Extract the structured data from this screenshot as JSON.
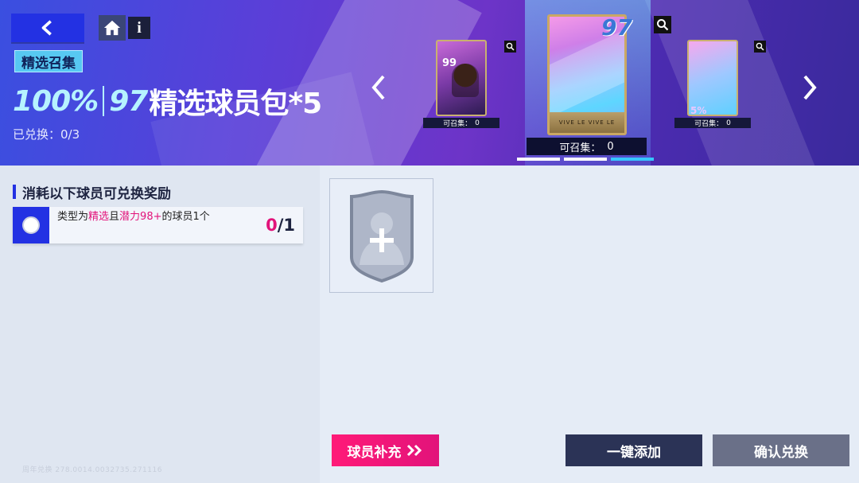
{
  "header": {
    "tag": "精选召集",
    "pack_percent": "100%",
    "pack_ovr": "97",
    "pack_name": "精选球员包*5",
    "redeemed_label": "已兑换：",
    "redeemed_value": "0/3"
  },
  "carousel": {
    "left_card": {
      "ovr": "99",
      "label": "可召集：",
      "count": "0"
    },
    "center_card": {
      "ovr": "97",
      "label": "可召集：",
      "count": "0",
      "foot": "VIVE LE  VIVE LE"
    },
    "right_card": {
      "label": "可召集：",
      "count": "0",
      "foil_text": "5%"
    },
    "pager_active_index": 3
  },
  "requirements": {
    "title": "消耗以下球员可兑换奖励",
    "rows": [
      {
        "text_a": "类型为",
        "text_b": "精选",
        "text_c": "且",
        "text_d": "潜力98+",
        "text_e": "的球员1个",
        "current": "0",
        "total": "/1"
      }
    ]
  },
  "buttons": {
    "supply": "球员补充",
    "auto_add": "一键添加",
    "confirm": "确认兑换"
  },
  "watermark": "周年兑换  278.0014.0032735.271116",
  "colors": {
    "accent_blue": "#2331e3",
    "accent_pink": "#e2137a",
    "dark_button": "#2b3356",
    "gray_button": "#6a7088"
  }
}
